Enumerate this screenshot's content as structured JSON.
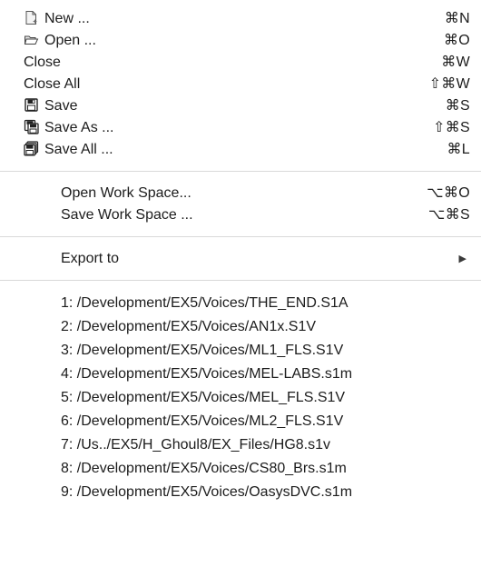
{
  "menu": {
    "file_items": [
      {
        "label": "New ...",
        "shortcut": "⌘N",
        "icon": "new-document-icon"
      },
      {
        "label": "Open ...",
        "shortcut": "⌘O",
        "icon": "open-folder-icon"
      },
      {
        "label": "Close",
        "shortcut": "⌘W"
      },
      {
        "label": "Close All",
        "shortcut": "⇧⌘W"
      },
      {
        "label": "Save",
        "shortcut": "⌘S",
        "icon": "floppy-disk-icon"
      },
      {
        "label": "Save As ...",
        "shortcut": "⇧⌘S",
        "icon": "save-as-icon"
      },
      {
        "label": "Save All ...",
        "shortcut": "⌘L",
        "icon": "save-all-icon"
      }
    ],
    "workspace_items": [
      {
        "label": "Open Work Space...",
        "shortcut": "⌥⌘O"
      },
      {
        "label": "Save Work Space ...",
        "shortcut": "⌥⌘S"
      }
    ],
    "export": {
      "label": "Export to",
      "arrow": "▶"
    },
    "recent_files": [
      "1: /Development/EX5/Voices/THE_END.S1A",
      "2: /Development/EX5/Voices/AN1x.S1V",
      "3: /Development/EX5/Voices/ML1_FLS.S1V",
      "4: /Development/EX5/Voices/MEL-LABS.s1m",
      "5: /Development/EX5/Voices/MEL_FLS.S1V",
      "6: /Development/EX5/Voices/ML2_FLS.S1V",
      "7: /Us../EX5/H_Ghoul8/EX_Files/HG8.s1v",
      "8: /Development/EX5/Voices/CS80_Brs.s1m",
      "9: /Development/EX5/Voices/OasysDVC.s1m"
    ]
  }
}
